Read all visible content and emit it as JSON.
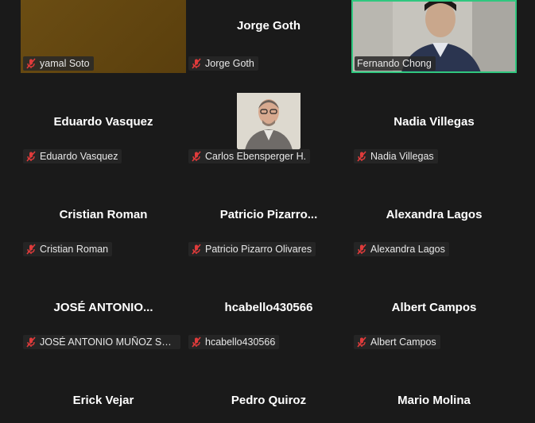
{
  "participants": [
    {
      "display_name": "",
      "tag": "yamal Soto"
    },
    {
      "display_name": "Jorge Goth",
      "tag": "Jorge Goth"
    },
    {
      "display_name": "",
      "tag": "Fernando Chong"
    },
    {
      "display_name": "Eduardo Vasquez",
      "tag": "Eduardo Vasquez"
    },
    {
      "display_name": "",
      "tag": "Carlos Ebensperger H."
    },
    {
      "display_name": "Nadia Villegas",
      "tag": "Nadia Villegas"
    },
    {
      "display_name": "Cristian Roman",
      "tag": "Cristian Roman"
    },
    {
      "display_name": "Patricio  Pizarro...",
      "tag": "Patricio Pizarro Olivares"
    },
    {
      "display_name": "Alexandra Lagos",
      "tag": "Alexandra Lagos"
    },
    {
      "display_name": "JOSÉ  ANTONIO...",
      "tag": "JOSÉ ANTONIO MUÑOZ SALV..."
    },
    {
      "display_name": "hcabello430566",
      "tag": "hcabello430566"
    },
    {
      "display_name": "Albert Campos",
      "tag": "Albert Campos"
    },
    {
      "display_name": "Erick Vejar",
      "tag": ""
    },
    {
      "display_name": "Pedro Quiroz",
      "tag": ""
    },
    {
      "display_name": "Mario Molina",
      "tag": ""
    }
  ],
  "colors": {
    "background": "#1a1a1a",
    "active_speaker_border": "#30c77f",
    "muted_icon": "#e03b3b"
  },
  "icons": {
    "muted": "microphone-muted-icon"
  }
}
